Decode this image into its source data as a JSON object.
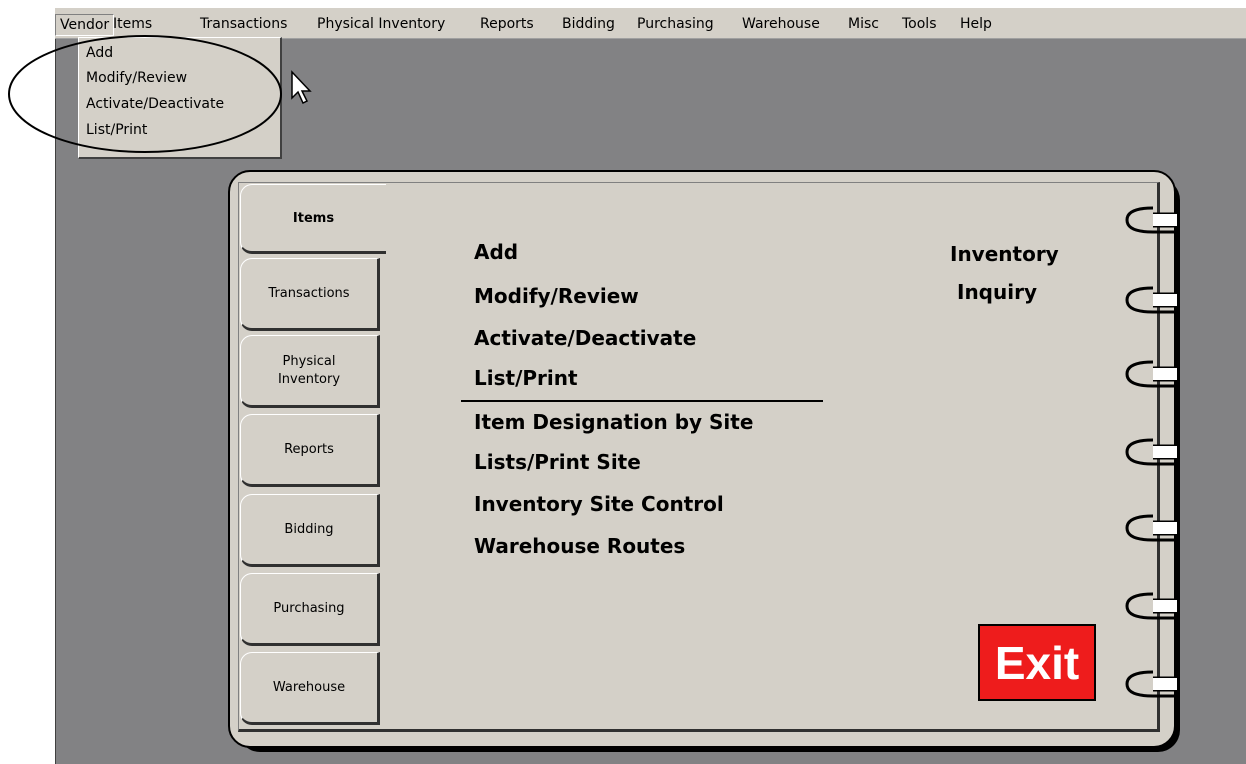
{
  "menubar": {
    "items": [
      "Vendor",
      "Items",
      "Transactions",
      "Physical Inventory",
      "Reports",
      "Bidding",
      "Purchasing",
      "Warehouse",
      "Misc",
      "Tools",
      "Help"
    ]
  },
  "vendor_menu": {
    "items": [
      "Add",
      "Modify/Review",
      "Activate/Deactivate",
      "List/Print"
    ]
  },
  "tabs": {
    "items": [
      "Items",
      "Transactions",
      "Physical\nInventory",
      "Reports",
      "Bidding",
      "Purchasing",
      "Warehouse"
    ]
  },
  "main": {
    "links": [
      "Add",
      "Modify/Review",
      "Activate/Deactivate",
      "List/Print"
    ],
    "site_links": [
      "Item Designation by Site",
      "Lists/Print Site",
      "Inventory Site Control",
      "Warehouse Routes"
    ],
    "inquiry_line1": "Inventory",
    "inquiry_line2": "Inquiry",
    "exit_label": "Exit"
  },
  "colors": {
    "exit_bg": "#ee1c1c",
    "workspace": "#828284",
    "panel": "#d4d0c8"
  },
  "icons": {
    "cursor": "arrow-cursor",
    "binder_rings": "binder-ring"
  }
}
